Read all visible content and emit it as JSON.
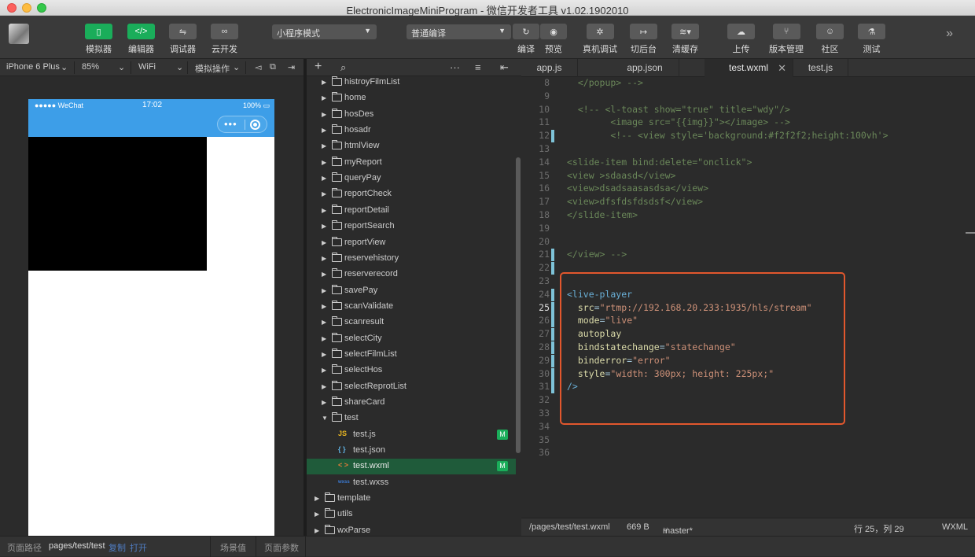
{
  "window": {
    "title": "ElectronicImageMiniProgram - 微信开发者工具 v1.02.1902010"
  },
  "toolbar": {
    "left_buttons": [
      {
        "label": "模拟器",
        "icon": "phone-icon",
        "glyph": "▯"
      },
      {
        "label": "编辑器",
        "icon": "code-icon",
        "glyph": "</>"
      },
      {
        "label": "调试器",
        "icon": "debug-icon",
        "glyph": "⇋"
      },
      {
        "label": "云开发",
        "icon": "cloud-link-icon",
        "glyph": "∞"
      }
    ],
    "mode_select": "小程序模式",
    "compile_select": "普通编译",
    "mid_buttons": [
      {
        "label": "编译",
        "icon": "refresh-icon",
        "glyph": "↻"
      },
      {
        "label": "预览",
        "icon": "eye-icon",
        "glyph": "◉"
      },
      {
        "label": "真机调试",
        "icon": "bug-icon",
        "glyph": "✲"
      },
      {
        "label": "切后台",
        "icon": "background-icon",
        "glyph": "↦"
      },
      {
        "label": "清缓存",
        "icon": "layers-icon",
        "glyph": "≋▾"
      }
    ],
    "right_buttons": [
      {
        "label": "上传",
        "icon": "upload-cloud-icon",
        "glyph": "☁"
      },
      {
        "label": "版本管理",
        "icon": "branch-icon",
        "glyph": "⑂"
      },
      {
        "label": "社区",
        "icon": "chat-icon",
        "glyph": "☺"
      },
      {
        "label": "测试",
        "icon": "flask-icon",
        "glyph": "⚗"
      }
    ],
    "more": "»"
  },
  "device_bar": {
    "device": "iPhone 6 Plus",
    "zoom": "85%",
    "network": "WiFi",
    "sim_ops": "模拟操作"
  },
  "phone": {
    "carrier": "●●●●● WeChat",
    "time": "17:02",
    "battery": "100%",
    "capsule_dots": "•••"
  },
  "tree": {
    "items": [
      {
        "name": "histroyFilmList",
        "type": "folder"
      },
      {
        "name": "home",
        "type": "folder"
      },
      {
        "name": "hosDes",
        "type": "folder"
      },
      {
        "name": "hosadr",
        "type": "folder"
      },
      {
        "name": "htmlView",
        "type": "folder"
      },
      {
        "name": "myReport",
        "type": "folder"
      },
      {
        "name": "queryPay",
        "type": "folder"
      },
      {
        "name": "reportCheck",
        "type": "folder"
      },
      {
        "name": "reportDetail",
        "type": "folder"
      },
      {
        "name": "reportSearch",
        "type": "folder"
      },
      {
        "name": "reportView",
        "type": "folder"
      },
      {
        "name": "reservehistory",
        "type": "folder"
      },
      {
        "name": "reserverecord",
        "type": "folder"
      },
      {
        "name": "savePay",
        "type": "folder"
      },
      {
        "name": "scanValidate",
        "type": "folder"
      },
      {
        "name": "scanresult",
        "type": "folder"
      },
      {
        "name": "selectCity",
        "type": "folder"
      },
      {
        "name": "selectFilmList",
        "type": "folder"
      },
      {
        "name": "selectHos",
        "type": "folder"
      },
      {
        "name": "selectReprotList",
        "type": "folder"
      },
      {
        "name": "shareCard",
        "type": "folder"
      },
      {
        "name": "test",
        "type": "open-folder"
      },
      {
        "name": "test.js",
        "type": "js",
        "badge": "M"
      },
      {
        "name": "test.json",
        "type": "json"
      },
      {
        "name": "test.wxml",
        "type": "wxml",
        "badge": "M",
        "selected": true
      },
      {
        "name": "test.wxss",
        "type": "wxss"
      },
      {
        "name": "template",
        "type": "root-folder"
      },
      {
        "name": "utils",
        "type": "root-folder"
      },
      {
        "name": "wxParse",
        "type": "root-folder"
      }
    ]
  },
  "tabs": [
    {
      "label": "app.js"
    },
    {
      "label": "app.json"
    },
    {
      "label": "test.wxml",
      "active": true
    },
    {
      "label": "test.js"
    }
  ],
  "editor": {
    "lines": [
      {
        "n": "8",
        "text": "  </popup> -->"
      },
      {
        "n": "9",
        "text": ""
      },
      {
        "n": "10",
        "text": "  <!-- <l-toast show=\"true\" title=\"wdy\"/>"
      },
      {
        "n": "11",
        "text": "        <image src=\"{{img}}\"></image> -->"
      },
      {
        "n": "12",
        "text": "        <!-- <view style='background:#f2f2f2;height:100vh'>"
      },
      {
        "n": "13",
        "text": ""
      },
      {
        "n": "14",
        "text": "<slide-item bind:delete=\"onclick\">"
      },
      {
        "n": "15",
        "text": "<view >sdaasd</view>"
      },
      {
        "n": "16",
        "text": "<view>dsadsaasasdsa</view>"
      },
      {
        "n": "17",
        "text": "<view>dfsfdsfdsdsf</view>"
      },
      {
        "n": "18",
        "text": "</slide-item>"
      },
      {
        "n": "19",
        "text": ""
      },
      {
        "n": "20",
        "text": ""
      },
      {
        "n": "21",
        "text": "</view> -->"
      },
      {
        "n": "22",
        "text": ""
      },
      {
        "n": "23",
        "text": ""
      },
      {
        "n": "24",
        "text": "<live-player"
      },
      {
        "n": "25",
        "text": "  src=\"rtmp://192.168.20.233:1935/hls/stream\""
      },
      {
        "n": "26",
        "text": "  mode=\"live\""
      },
      {
        "n": "27",
        "text": "  autoplay"
      },
      {
        "n": "28",
        "text": "  bindstatechange=\"statechange\""
      },
      {
        "n": "29",
        "text": "  binderror=\"error\""
      },
      {
        "n": "30",
        "text": "  style=\"width: 300px; height: 225px;\""
      },
      {
        "n": "31",
        "text": "/>"
      },
      {
        "n": "32",
        "text": ""
      },
      {
        "n": "33",
        "text": ""
      },
      {
        "n": "34",
        "text": ""
      },
      {
        "n": "35",
        "text": ""
      },
      {
        "n": "36",
        "text": ""
      }
    ]
  },
  "editor_status": {
    "path": "/pages/test/test.wxml",
    "size": "669 B",
    "branch": "master*",
    "cursor": "行 25，列 29",
    "lang": "WXML"
  },
  "bottom": {
    "path_label": "页面路径",
    "path": "pages/test/test",
    "copy": "复制",
    "open": "打开",
    "scene": "场景值",
    "params": "页面参数"
  }
}
